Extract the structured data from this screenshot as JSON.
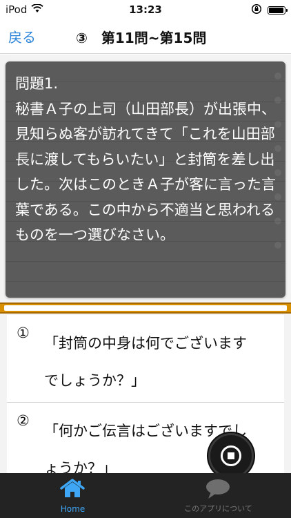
{
  "status_bar": {
    "carrier": "iPod",
    "time": "13:23"
  },
  "nav": {
    "back_label": "戻る",
    "title": "③　第11問~第15問"
  },
  "question": {
    "text": "問題1.\n秘書Ａ子の上司（山田部長）が出張中、見知らぬ客が訪れてきて「これを山田部長に渡してもらいたい」と封筒を差し出した。次はこのときＡ子が客に言った言葉である。この中から不適当と思われるものを一つ選びなさい。"
  },
  "answers": [
    {
      "number": "①",
      "text": "「封筒の中身は何でございます\nでしょうか？」"
    },
    {
      "number": "②",
      "text": "「何かご伝言はございますでし\nょうか？」"
    }
  ],
  "tabbar": {
    "home_label": "Home",
    "about_label": "このアプリについて"
  },
  "colors": {
    "accent_blue": "#2f86d9",
    "card_bg": "#5b5b5b",
    "divider_orange": "#d89000",
    "tabbar_bg": "#232323"
  }
}
